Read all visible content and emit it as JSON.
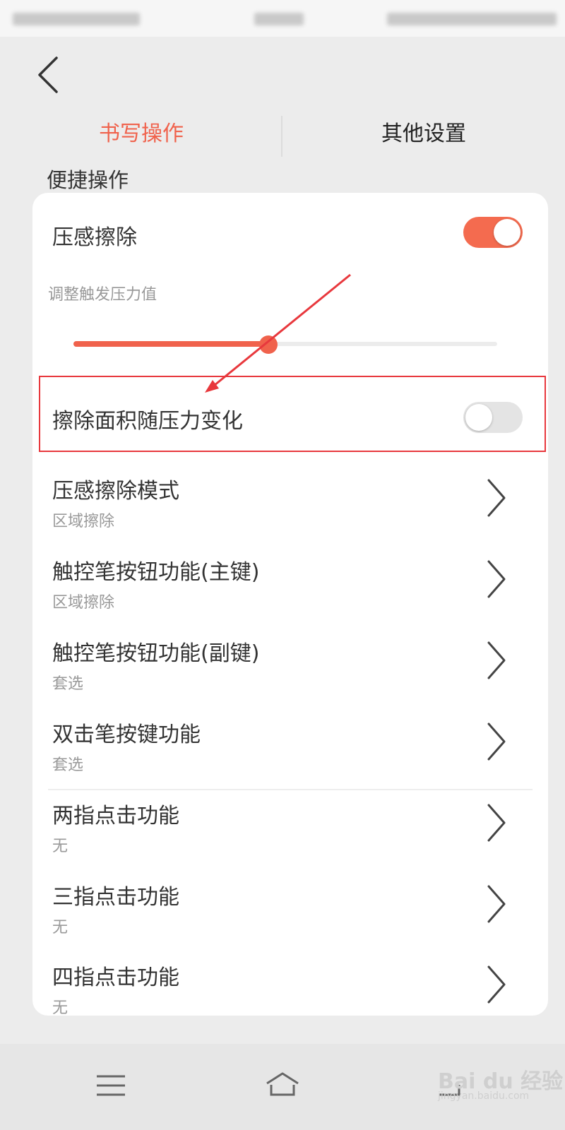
{
  "tabs": {
    "active": "书写操作",
    "other": "其他设置"
  },
  "section": {
    "title": "便捷操作"
  },
  "pressure_erase": {
    "label": "压感擦除",
    "enabled": true,
    "hint": "调整触发压力值",
    "slider_value_percent": 46
  },
  "area_follows_pressure": {
    "label": "擦除面积随压力变化",
    "enabled": false
  },
  "settings_list": [
    {
      "title": "压感擦除模式",
      "value": "区域擦除"
    },
    {
      "title": "触控笔按钮功能(主键)",
      "value": "区域擦除"
    },
    {
      "title": "触控笔按钮功能(副键)",
      "value": "套选"
    },
    {
      "title": "双击笔按键功能",
      "value": "套选"
    },
    {
      "title": "两指点击功能",
      "value": "无"
    },
    {
      "title": "三指点击功能",
      "value": "无"
    },
    {
      "title": "四指点击功能",
      "value": "无"
    }
  ],
  "watermark": {
    "text": "Bai du 经验",
    "url": "jingyan.baidu.com"
  },
  "colors": {
    "accent": "#f0624c",
    "annotation": "#e8383d"
  }
}
